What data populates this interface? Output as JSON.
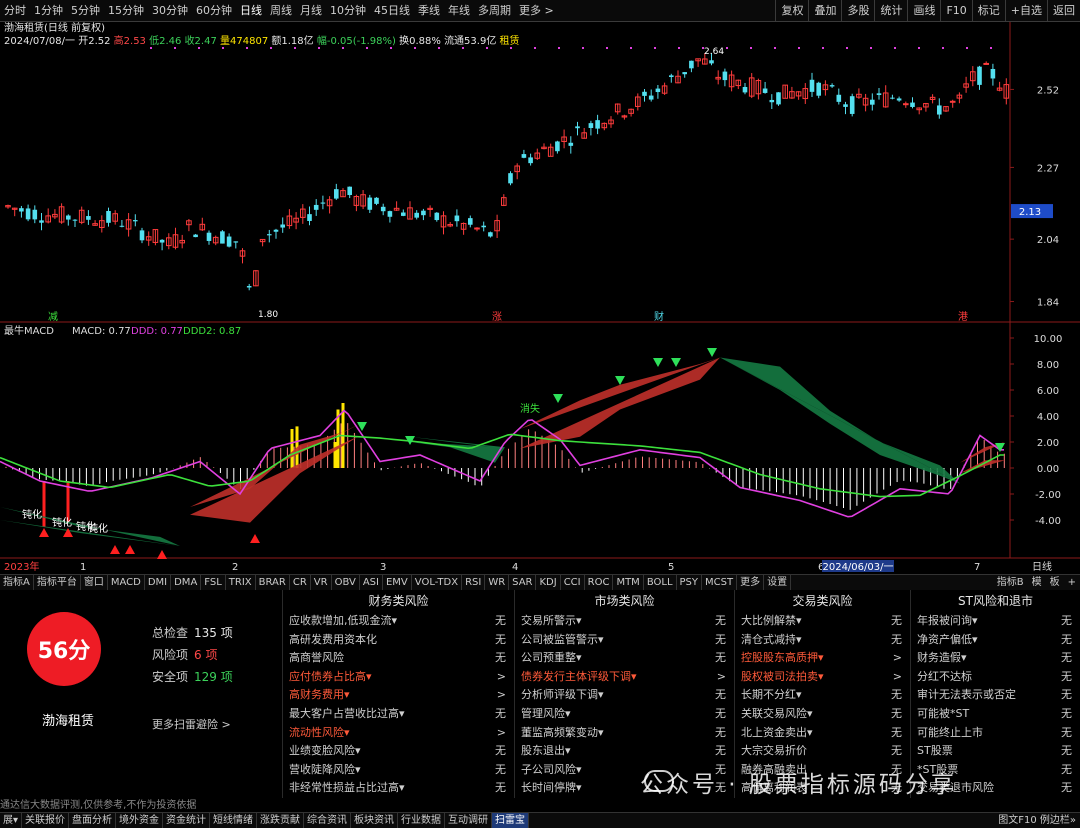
{
  "toolbar": {
    "periods": [
      "分时",
      "1分钟",
      "5分钟",
      "15分钟",
      "30分钟",
      "60分钟",
      "日线",
      "周线",
      "月线",
      "10分钟",
      "45日线",
      "季线",
      "年线",
      "多周期",
      "更多 >"
    ],
    "active_period": "日线",
    "right_buttons": [
      "复权",
      "叠加",
      "多股",
      "统计",
      "画线",
      "F10",
      "标记",
      "+自选",
      "返回"
    ]
  },
  "stock": {
    "title": "渤海租赁(日线 前复权)",
    "date": "2024/07/08/一",
    "open": "开2.52",
    "high": "高2.53",
    "low": "低2.46",
    "close": "收2.47",
    "volume": "量474807",
    "amount": "额1.18亿",
    "change": "幅-0.05(-1.98%)",
    "turnover": "换0.88%",
    "float_cap": "流通53.9亿",
    "tag": "租赁"
  },
  "price_axis": {
    "ticks": [
      "2.52",
      "2.27",
      "2.04",
      "1.84"
    ],
    "current": "2.13"
  },
  "price_marks": {
    "high": "2.64",
    "low": "1.80"
  },
  "event_tags": [
    "减",
    "涨",
    "财",
    "港"
  ],
  "macd": {
    "title": "最牛MACD",
    "macd_label": "MACD: 0.77",
    "ddd_label": "DDD: 0.77",
    "ddd2_label": "DDD2: 0.87",
    "axis": [
      "10.00",
      "8.00",
      "6.00",
      "4.00",
      "2.00",
      "0.00",
      "-2.00",
      "-4.00"
    ],
    "labels": [
      "钝化",
      "钝化",
      "钝化",
      "钝化",
      "消失"
    ]
  },
  "time_axis": {
    "start": "2023年",
    "marks": [
      "1",
      "2",
      "3",
      "4",
      "5",
      "6",
      "7"
    ],
    "cursor": "2024/06/03/一",
    "right": "日线"
  },
  "tabs": [
    "指标A",
    "指标平台",
    "窗口",
    "MACD",
    "DMI",
    "DMA",
    "FSL",
    "TRIX",
    "BRAR",
    "CR",
    "VR",
    "OBV",
    "ASI",
    "EMV",
    "VOL-TDX",
    "RSI",
    "WR",
    "SAR",
    "KDJ",
    "CCI",
    "ROC",
    "MTM",
    "BOLL",
    "PSY",
    "MCST",
    "更多",
    "设置"
  ],
  "tabs_right": [
    "指标B",
    "模",
    "板",
    "+"
  ],
  "risk": {
    "score": "56分",
    "company": "渤海租赁",
    "total_label": "总检查",
    "total": "135 项",
    "risk_label": "风险项",
    "risk_count": "6 项",
    "safe_label": "安全项",
    "safe_count": "129 项",
    "more": "更多扫雷避险 >",
    "disclaimer": "通达信大数据评测,仅供参考,不作为投资依据",
    "columns": [
      {
        "title": "财务类风险",
        "items": [
          {
            "label": "应收款增加,低现金流▾",
            "status": "无",
            "hot": false
          },
          {
            "label": "高研发费用资本化",
            "status": "无",
            "hot": false
          },
          {
            "label": "高商誉风险",
            "status": "无",
            "hot": false
          },
          {
            "label": "应付债券占比高▾",
            "status": ">",
            "hot": true
          },
          {
            "label": "高财务费用▾",
            "status": ">",
            "hot": true
          },
          {
            "label": "最大客户占营收比过高▾",
            "status": "无",
            "hot": false
          },
          {
            "label": "流动性风险▾",
            "status": ">",
            "hot": true
          },
          {
            "label": "业绩变脸风险▾",
            "status": "无",
            "hot": false
          },
          {
            "label": "营收陡降风险▾",
            "status": "无",
            "hot": false
          },
          {
            "label": "非经常性损益占比过高▾",
            "status": "无",
            "hot": false
          }
        ]
      },
      {
        "title": "市场类风险",
        "items": [
          {
            "label": "交易所警示▾",
            "status": "无",
            "hot": false
          },
          {
            "label": "公司被监管警示▾",
            "status": "无",
            "hot": false
          },
          {
            "label": "公司预重整▾",
            "status": "无",
            "hot": false
          },
          {
            "label": "债券发行主体评级下调▾",
            "status": ">",
            "hot": true
          },
          {
            "label": "分析师评级下调▾",
            "status": "无",
            "hot": false
          },
          {
            "label": "管理风险▾",
            "status": "无",
            "hot": false
          },
          {
            "label": "董监高频繁变动▾",
            "status": "无",
            "hot": false
          },
          {
            "label": "股东退出▾",
            "status": "无",
            "hot": false
          },
          {
            "label": "子公司风险▾",
            "status": "无",
            "hot": false
          },
          {
            "label": "长时间停牌▾",
            "status": "无",
            "hot": false
          }
        ]
      },
      {
        "title": "交易类风险",
        "items": [
          {
            "label": "大比例解禁▾",
            "status": "无",
            "hot": false
          },
          {
            "label": "清仓式减持▾",
            "status": "无",
            "hot": false
          },
          {
            "label": "控股股东高质押▾",
            "status": ">",
            "hot": true
          },
          {
            "label": "股权被司法拍卖▾",
            "status": ">",
            "hot": true
          },
          {
            "label": "长期不分红▾",
            "status": "无",
            "hot": false
          },
          {
            "label": "关联交易风险▾",
            "status": "无",
            "hot": false
          },
          {
            "label": "北上资金卖出▾",
            "status": "无",
            "hot": false
          },
          {
            "label": "大宗交易折价",
            "status": "无",
            "hot": false
          },
          {
            "label": "融券高融卖出",
            "status": "无",
            "hot": false
          },
          {
            "label": "高偏离利润表",
            "status": "无",
            "hot": false
          }
        ]
      },
      {
        "title": "ST风险和退市",
        "items": [
          {
            "label": "年报被问询▾",
            "status": "无",
            "hot": false
          },
          {
            "label": "净资产偏低▾",
            "status": "无",
            "hot": false
          },
          {
            "label": "财务造假▾",
            "status": "无",
            "hot": false
          },
          {
            "label": "分红不达标",
            "status": "无",
            "hot": false
          },
          {
            "label": "审计无法表示或否定",
            "status": "无",
            "hot": false
          },
          {
            "label": "可能被*ST",
            "status": "无",
            "hot": false
          },
          {
            "label": "可能终止上市",
            "status": "无",
            "hot": false
          },
          {
            "label": "ST股票",
            "status": "无",
            "hot": false
          },
          {
            "label": "*ST股票",
            "status": "无",
            "hot": false
          },
          {
            "label": "交易类退市风险",
            "status": "无",
            "hot": false
          }
        ]
      }
    ]
  },
  "bottom": {
    "tabs": [
      "展▾",
      "关联报价",
      "盘面分析",
      "境外资金",
      "资金统计",
      "短线情绪",
      "涨跌贡献",
      "综合资讯",
      "板块资讯",
      "行业数据",
      "互动调研",
      "扫雷宝"
    ],
    "selected": "扫雷宝",
    "right": "图文F10 例边栏»"
  },
  "watermark": "公众号 · 股票指标源码分享",
  "colors": {
    "up": "#ff3c3c",
    "down": "#54e0f0",
    "macd_line": "#e040e0",
    "signal_line": "#3ce03c",
    "hist_up": "#ff8080",
    "hist_down": "#ffffff",
    "highlight": "#ffe600",
    "band_pos": "#c0302a",
    "band_neg": "#157a42",
    "score_red": "#ee1c25"
  }
}
